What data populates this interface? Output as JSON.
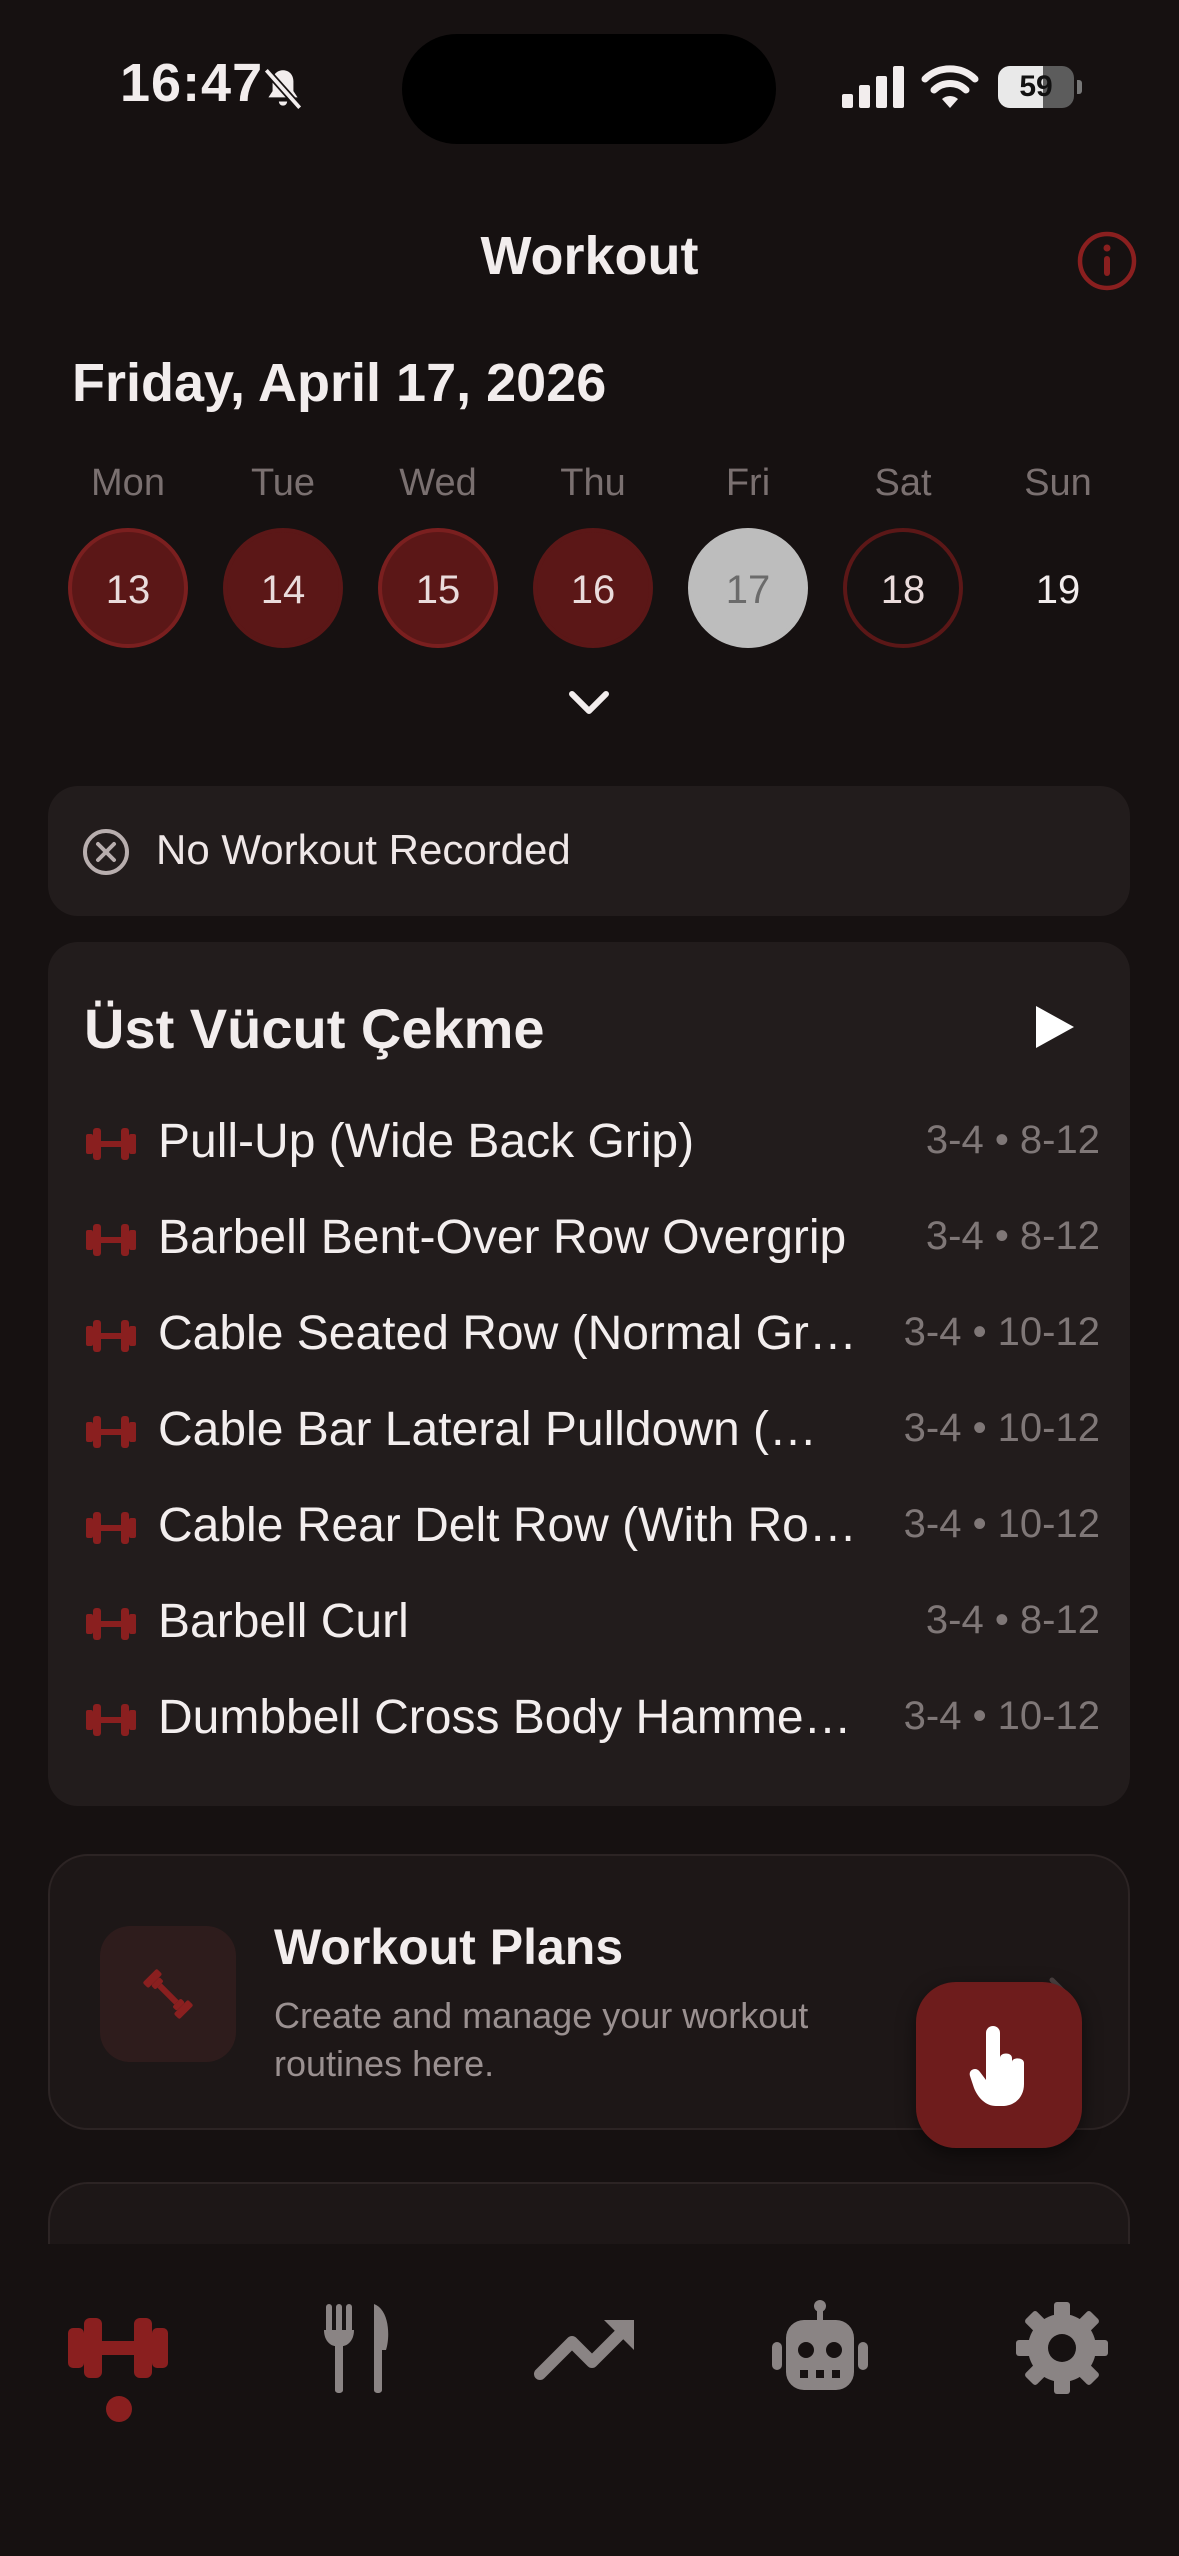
{
  "status_bar": {
    "time": "16:47",
    "battery": "59",
    "battery_level": 0.59
  },
  "header": {
    "title": "Workout"
  },
  "date": "Friday, April 17, 2026",
  "week": [
    {
      "label": "Mon",
      "day": "13",
      "state": "done"
    },
    {
      "label": "Tue",
      "day": "14",
      "state": "rest"
    },
    {
      "label": "Wed",
      "day": "15",
      "state": "done"
    },
    {
      "label": "Thu",
      "day": "16",
      "state": "rest"
    },
    {
      "label": "Fri",
      "day": "17",
      "state": "today"
    },
    {
      "label": "Sat",
      "day": "18",
      "state": "next"
    },
    {
      "label": "Sun",
      "day": "19",
      "state": "plain"
    }
  ],
  "no_workout": {
    "text": "No Workout Recorded"
  },
  "plan": {
    "title": "Üst Vücut Çekme",
    "exercises": [
      {
        "name": "Pull-Up (Wide Back Grip)",
        "meta": "3-4 • 8-12"
      },
      {
        "name": "Barbell Bent-Over Row Overgrip",
        "meta": "3-4 • 8-12"
      },
      {
        "name": "Cable Seated Row (Normal Grip)",
        "meta": "3-4 • 10-12"
      },
      {
        "name": "Cable Bar Lateral Pulldown (Wide Grip)",
        "meta": "3-4 • 10-12"
      },
      {
        "name": "Cable Rear Delt Row (With Rope)",
        "meta": "3-4 • 10-12"
      },
      {
        "name": "Barbell Curl",
        "meta": "3-4 • 8-12"
      },
      {
        "name": "Dumbbell Cross Body Hammer Curl",
        "meta": "3-4 • 10-12"
      }
    ]
  },
  "workout_plans": {
    "title": "Workout Plans",
    "description": "Create and manage your workout routines here."
  },
  "tabs": [
    {
      "icon": "dumbbell-icon",
      "active": true
    },
    {
      "icon": "fork-knife-icon",
      "active": false
    },
    {
      "icon": "trending-up-icon",
      "active": false
    },
    {
      "icon": "robot-icon",
      "active": false
    },
    {
      "icon": "gear-icon",
      "active": false
    }
  ],
  "colors": {
    "background": "#161111",
    "card": "#221c1c",
    "accent": "#8a1f1f",
    "accent_dark": "#5b1717",
    "today": "#bdbdbd",
    "muted_text": "#7f7777"
  }
}
